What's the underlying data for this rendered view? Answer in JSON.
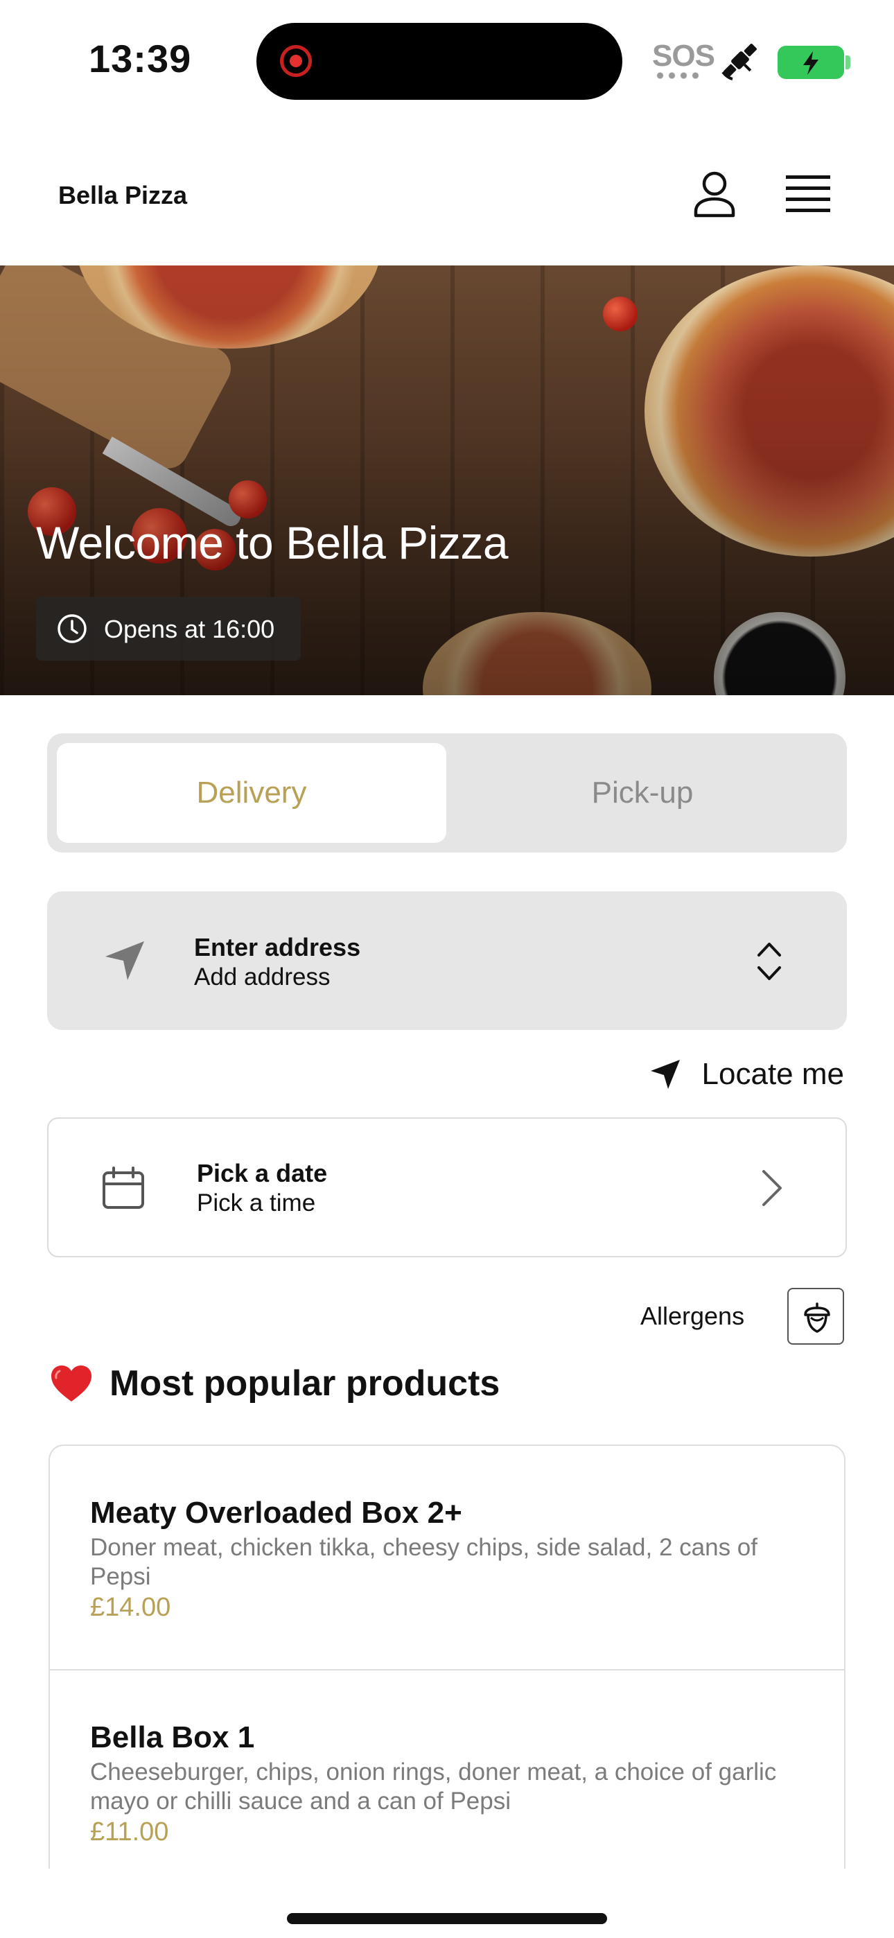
{
  "status_bar": {
    "time": "13:39",
    "sos_label": "SOS"
  },
  "header": {
    "brand": "Bella Pizza",
    "profile_icon": "user-icon",
    "menu_icon": "hamburger-menu-icon"
  },
  "hero": {
    "title": "Welcome to Bella Pizza",
    "hours": "Opens at 16:00",
    "hours_icon": "clock-icon"
  },
  "order_mode": {
    "options": [
      "Delivery",
      "Pick-up"
    ],
    "selected": "Delivery"
  },
  "address": {
    "title": "Enter address",
    "subtitle": "Add address",
    "icon": "navigation-arrow-icon",
    "toggle_icon": "chevron-up-down-icon"
  },
  "locate": {
    "label": "Locate me",
    "icon": "location-arrow-icon"
  },
  "schedule": {
    "title": "Pick a date",
    "subtitle": "Pick a time",
    "icon": "calendar-icon"
  },
  "allergens": {
    "label": "Allergens",
    "icon": "acorn-icon"
  },
  "popular": {
    "title": "Most popular products",
    "products": [
      {
        "name": "Meaty Overloaded Box 2+",
        "description": "Doner meat, chicken tikka, cheesy chips, side salad, 2 cans of Pepsi",
        "price": "£14.00"
      },
      {
        "name": "Bella Box 1",
        "description": "Cheeseburger, chips, onion rings, doner meat, a choice of garlic mayo or chilli sauce and a can of Pepsi",
        "price": "£11.00"
      }
    ]
  },
  "colors": {
    "accent": "#b8a054",
    "segment_bg": "#e5e5e5",
    "battery": "#34c759"
  }
}
